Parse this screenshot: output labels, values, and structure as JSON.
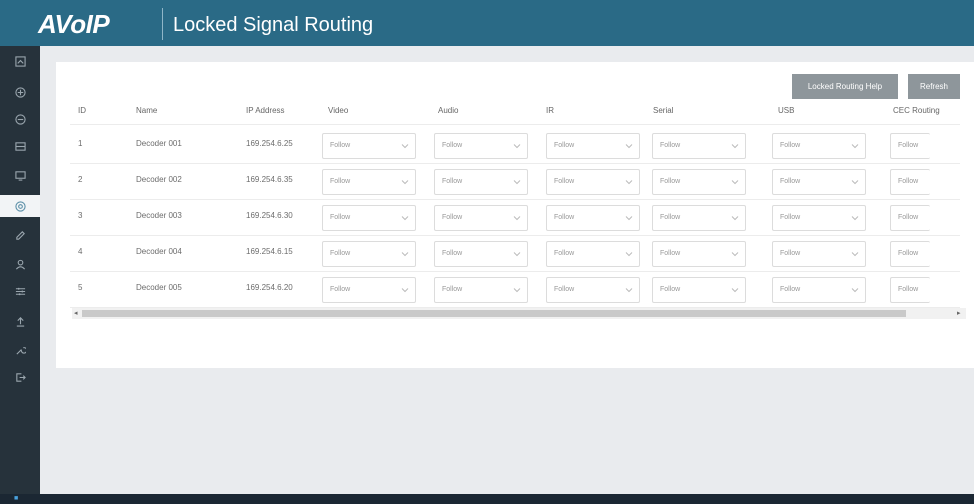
{
  "header": {
    "logo": "AVoIP",
    "title": "Locked Signal Routing"
  },
  "sidebar": {
    "items": [
      {
        "icon": "dashboard-icon"
      },
      {
        "icon": "add-circle-icon"
      },
      {
        "icon": "layers-icon"
      },
      {
        "icon": "encoder-icon"
      },
      {
        "icon": "monitor-icon"
      },
      {
        "icon": "routing-icon",
        "active": true
      },
      {
        "icon": "edit-icon"
      },
      {
        "icon": "user-icon"
      },
      {
        "icon": "settings-sliders-icon"
      },
      {
        "icon": "upload-icon"
      },
      {
        "icon": "wrench-icon"
      },
      {
        "icon": "logout-icon"
      }
    ]
  },
  "toolbar": {
    "help_label": "Locked Routing Help",
    "refresh_label": "Refresh"
  },
  "table": {
    "headers": [
      "ID",
      "Name",
      "IP Address",
      "Video",
      "Audio",
      "IR",
      "Serial",
      "USB",
      "CEC Routing"
    ],
    "rows": [
      {
        "id": "1",
        "name": "Decoder 001",
        "ip": "169.254.6.25",
        "video": "Follow",
        "audio": "Follow",
        "ir": "Follow",
        "serial": "Follow",
        "usb": "Follow",
        "cec": "Follow"
      },
      {
        "id": "2",
        "name": "Decoder 002",
        "ip": "169.254.6.35",
        "video": "Follow",
        "audio": "Follow",
        "ir": "Follow",
        "serial": "Follow",
        "usb": "Follow",
        "cec": "Follow"
      },
      {
        "id": "3",
        "name": "Decoder 003",
        "ip": "169.254.6.30",
        "video": "Follow",
        "audio": "Follow",
        "ir": "Follow",
        "serial": "Follow",
        "usb": "Follow",
        "cec": "Follow"
      },
      {
        "id": "4",
        "name": "Decoder 004",
        "ip": "169.254.6.15",
        "video": "Follow",
        "audio": "Follow",
        "ir": "Follow",
        "serial": "Follow",
        "usb": "Follow",
        "cec": "Follow"
      },
      {
        "id": "5",
        "name": "Decoder 005",
        "ip": "169.254.6.20",
        "video": "Follow",
        "audio": "Follow",
        "ir": "Follow",
        "serial": "Follow",
        "usb": "Follow",
        "cec": "Follow"
      }
    ]
  },
  "colors": {
    "header": "#2a6a86",
    "sidebar": "#26323b",
    "button": "#8e969b"
  }
}
